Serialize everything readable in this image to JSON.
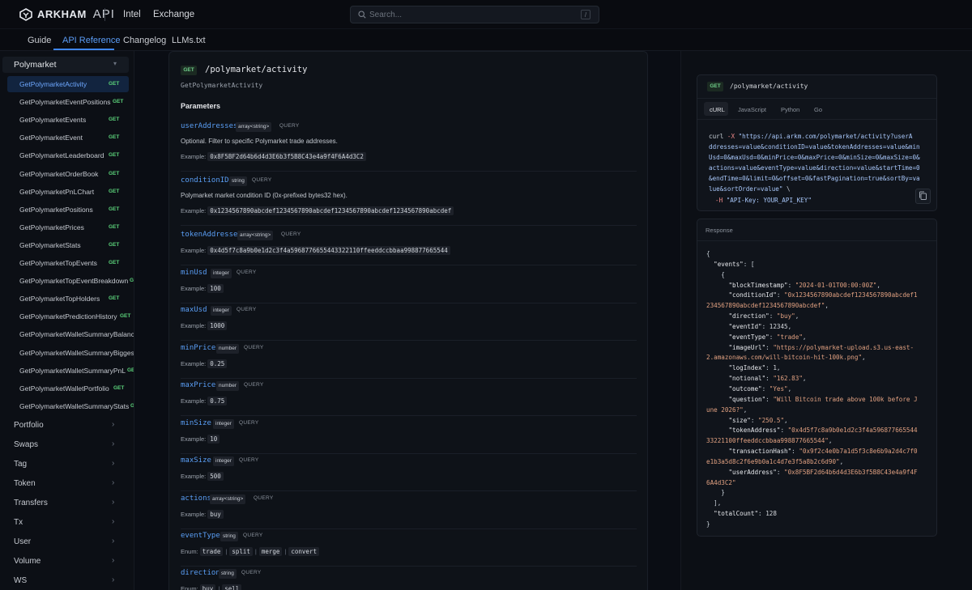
{
  "header": {
    "brand": "ARKHAM",
    "brand_suffix": "API",
    "nav": [
      "Intel",
      "Exchange"
    ],
    "search_placeholder": "Search...",
    "search_shortcut": "/"
  },
  "tabs": [
    {
      "label": "Guide",
      "active": false
    },
    {
      "label": "API Reference",
      "active": true
    },
    {
      "label": "Changelog",
      "active": false
    },
    {
      "label": "LLMs.txt",
      "active": false
    }
  ],
  "sidebar": {
    "group": "Polymarket",
    "method_label": "GET",
    "items": [
      {
        "label": "GetPolymarketActivity",
        "active": true
      },
      {
        "label": "GetPolymarketEventPositions"
      },
      {
        "label": "GetPolymarketEvents"
      },
      {
        "label": "GetPolymarketEvent"
      },
      {
        "label": "GetPolymarketLeaderboard"
      },
      {
        "label": "GetPolymarketOrderBook"
      },
      {
        "label": "GetPolymarketPnLChart"
      },
      {
        "label": "GetPolymarketPositions"
      },
      {
        "label": "GetPolymarketPrices"
      },
      {
        "label": "GetPolymarketStats"
      },
      {
        "label": "GetPolymarketTopEvents"
      },
      {
        "label": "GetPolymarketTopEventBreakdown"
      },
      {
        "label": "GetPolymarketTopHolders"
      },
      {
        "label": "GetPolymarketPredictionHistory"
      },
      {
        "label": "GetPolymarketWalletSummaryBalance"
      },
      {
        "label": "GetPolymarketWalletSummaryBiggestW"
      },
      {
        "label": "GetPolymarketWalletSummaryPnL"
      },
      {
        "label": "GetPolymarketWalletPortfolio"
      },
      {
        "label": "GetPolymarketWalletSummaryStats"
      }
    ],
    "categories": [
      "Portfolio",
      "Swaps",
      "Tag",
      "Token",
      "Transfers",
      "Tx",
      "User",
      "Volume",
      "WS"
    ]
  },
  "endpoint": {
    "method": "GET",
    "path": "/polymarket/activity",
    "operation_id": "GetPolymarketActivity",
    "params_title": "Parameters",
    "query_label": "QUERY",
    "example_label": "Example:",
    "enum_label": "Enum:",
    "params": [
      {
        "name": "userAddresses",
        "type": "array<string>",
        "desc": "Optional. Filter to specific Polymarket trade addresses.",
        "example": "0x8F5BF2d64b6d4d3E6b3f5B8C43e4a9f4F6A4d3C2"
      },
      {
        "name": "conditionID",
        "type": "string",
        "desc": "Polymarket market condition ID (0x-prefixed bytes32 hex).",
        "example": "0x1234567890abcdef1234567890abcdef1234567890abcdef1234567890abcdef"
      },
      {
        "name": "tokenAddresses",
        "type": "array<string>",
        "example": "0x4d5f7c8a9b0e1d2c3f4a5968776655443322110ffeeddccbbaa998877665544"
      },
      {
        "name": "minUsd",
        "type": "integer",
        "example": "100"
      },
      {
        "name": "maxUsd",
        "type": "integer",
        "example": "1000"
      },
      {
        "name": "minPrice",
        "type": "number",
        "example": "0.25"
      },
      {
        "name": "maxPrice",
        "type": "number",
        "example": "0.75"
      },
      {
        "name": "minSize",
        "type": "integer",
        "example": "10"
      },
      {
        "name": "maxSize",
        "type": "integer",
        "example": "500"
      },
      {
        "name": "actions",
        "type": "array<string>",
        "example": "buy"
      },
      {
        "name": "eventType",
        "type": "string",
        "enum": [
          "trade",
          "split",
          "merge",
          "convert"
        ]
      },
      {
        "name": "direction",
        "type": "string",
        "enum": [
          "buy",
          "sell"
        ]
      }
    ]
  },
  "code_panel": {
    "method": "GET",
    "path": "/polymarket/activity",
    "languages": [
      "cURL",
      "JavaScript",
      "Python",
      "Go"
    ],
    "active_language": "cURL",
    "curl_cmd": "curl",
    "curl_flag": "-X",
    "curl_url_lines": [
      "\"https://api.arkm.com/polymarket/activity?userA",
      "ddresses=value&conditionID=value&tokenAddresses=value&min",
      "Usd=0&maxUsd=0&minPrice=0&maxPrice=0&minSize=0&maxSize=0&",
      "actions=value&eventType=value&direction=value&startTime=0",
      "&endTime=0&limit=0&offset=0&fastPagination=true&sortBy=va",
      "lue&sortOrder=value\""
    ],
    "line_continuation": "\\",
    "header_flag": "-H",
    "header_value": "\"API-Key: YOUR_API_KEY\""
  },
  "response": {
    "title": "Response",
    "lines": [
      [
        [
          "p",
          "{"
        ]
      ],
      [
        [
          "p",
          "  "
        ],
        [
          "k",
          "\"events\""
        ],
        [
          "p",
          ": ["
        ]
      ],
      [
        [
          "p",
          "    {"
        ]
      ],
      [
        [
          "p",
          "      "
        ],
        [
          "k",
          "\"blockTimestamp\""
        ],
        [
          "p",
          ": "
        ],
        [
          "s",
          "\"2024-01-01T00:00:00Z\""
        ],
        [
          "p",
          ","
        ]
      ],
      [
        [
          "p",
          "      "
        ],
        [
          "k",
          "\"conditionId\""
        ],
        [
          "p",
          ": "
        ],
        [
          "s",
          "\"0x1234567890abcdef1234567890abcdef1"
        ]
      ],
      [
        [
          "s",
          "234567890abcdef1234567890abcdef\""
        ],
        [
          "p",
          ","
        ]
      ],
      [
        [
          "p",
          "      "
        ],
        [
          "k",
          "\"direction\""
        ],
        [
          "p",
          ": "
        ],
        [
          "s",
          "\"buy\""
        ],
        [
          "p",
          ","
        ]
      ],
      [
        [
          "p",
          "      "
        ],
        [
          "k",
          "\"eventId\""
        ],
        [
          "p",
          ": "
        ],
        [
          "n",
          "12345"
        ],
        [
          "p",
          ","
        ]
      ],
      [
        [
          "p",
          "      "
        ],
        [
          "k",
          "\"eventType\""
        ],
        [
          "p",
          ": "
        ],
        [
          "s",
          "\"trade\""
        ],
        [
          "p",
          ","
        ]
      ],
      [
        [
          "p",
          "      "
        ],
        [
          "k",
          "\"imageUrl\""
        ],
        [
          "p",
          ": "
        ],
        [
          "s",
          "\"https://polymarket-upload.s3.us-east-"
        ]
      ],
      [
        [
          "s",
          "2.amazonaws.com/will-bitcoin-hit-100k.png\""
        ],
        [
          "p",
          ","
        ]
      ],
      [
        [
          "p",
          "      "
        ],
        [
          "k",
          "\"logIndex\""
        ],
        [
          "p",
          ": "
        ],
        [
          "n",
          "1"
        ],
        [
          "p",
          ","
        ]
      ],
      [
        [
          "p",
          "      "
        ],
        [
          "k",
          "\"notional\""
        ],
        [
          "p",
          ": "
        ],
        [
          "s",
          "\"162.83\""
        ],
        [
          "p",
          ","
        ]
      ],
      [
        [
          "p",
          "      "
        ],
        [
          "k",
          "\"outcome\""
        ],
        [
          "p",
          ": "
        ],
        [
          "s",
          "\"Yes\""
        ],
        [
          "p",
          ","
        ]
      ],
      [
        [
          "p",
          "      "
        ],
        [
          "k",
          "\"question\""
        ],
        [
          "p",
          ": "
        ],
        [
          "s",
          "\"Will Bitcoin trade above 100k before J"
        ]
      ],
      [
        [
          "s",
          "une 2026?\""
        ],
        [
          "p",
          ","
        ]
      ],
      [
        [
          "p",
          "      "
        ],
        [
          "k",
          "\"size\""
        ],
        [
          "p",
          ": "
        ],
        [
          "s",
          "\"250.5\""
        ],
        [
          "p",
          ","
        ]
      ],
      [
        [
          "p",
          "      "
        ],
        [
          "k",
          "\"tokenAddress\""
        ],
        [
          "p",
          ": "
        ],
        [
          "s",
          "\"0x4d5f7c8a9b0e1d2c3f4a596877665544"
        ]
      ],
      [
        [
          "s",
          "33221100ffeeddccbbaa998877665544\""
        ],
        [
          "p",
          ","
        ]
      ],
      [
        [
          "p",
          "      "
        ],
        [
          "k",
          "\"transactionHash\""
        ],
        [
          "p",
          ": "
        ],
        [
          "s",
          "\"0x9f2c4e0b7a1d5f3c8e6b9a2d4c7f0"
        ]
      ],
      [
        [
          "s",
          "e1b3a5d8c2f6e9b0a1c4d7e3f5a8b2c6d90\""
        ],
        [
          "p",
          ","
        ]
      ],
      [
        [
          "p",
          "      "
        ],
        [
          "k",
          "\"userAddress\""
        ],
        [
          "p",
          ": "
        ],
        [
          "s",
          "\"0x8F5BF2d64b6d4d3E6b3f5B8C43e4a9f4F"
        ]
      ],
      [
        [
          "s",
          "6A4d3C2\""
        ]
      ],
      [
        [
          "p",
          "    }"
        ]
      ],
      [
        [
          "p",
          "  ],"
        ]
      ],
      [
        [
          "p",
          "  "
        ],
        [
          "k",
          "\"totalCount\""
        ],
        [
          "p",
          ": "
        ],
        [
          "n",
          "128"
        ]
      ],
      [
        [
          "p",
          "}"
        ]
      ]
    ]
  },
  "colors": {
    "accent": "#3f86ee",
    "get_badge": "#5bd27a",
    "param_name": "#5a9ef5",
    "json_string": "#e0a080",
    "background": "#0a0d14"
  }
}
